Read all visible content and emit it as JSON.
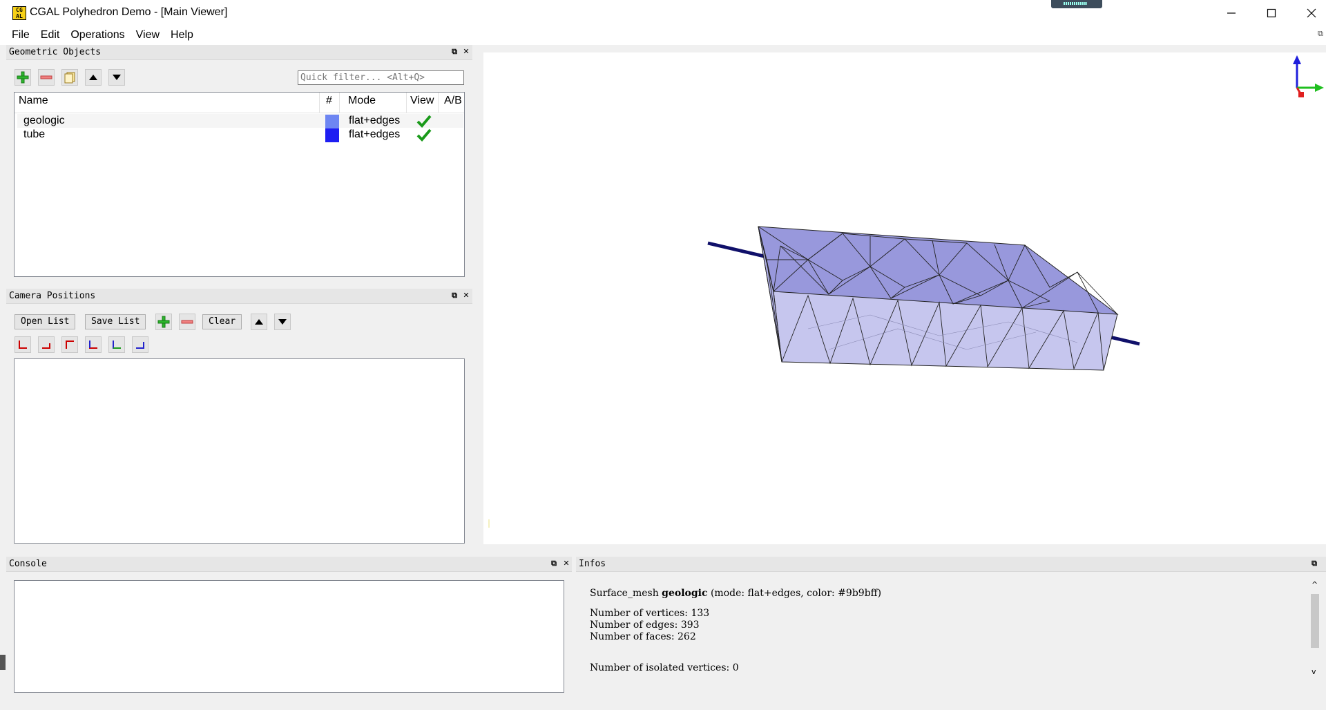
{
  "window": {
    "title": "CGAL Polyhedron Demo - [Main Viewer]",
    "icon_text_top": "CG",
    "icon_text_bottom": "AL"
  },
  "menu": [
    "File",
    "Edit",
    "Operations",
    "View",
    "Help"
  ],
  "geometric_objects": {
    "title": "Geometric Objects",
    "filter_placeholder": "Quick filter... <Alt+Q>",
    "columns": [
      "Name",
      "#",
      "Mode",
      "View",
      "A/B"
    ],
    "rows": [
      {
        "name": "geologic",
        "color": "#6e86f2",
        "mode": "flat+edges",
        "visible": true
      },
      {
        "name": "tube",
        "color": "#1e1ef2",
        "mode": "flat+edges",
        "visible": true
      }
    ]
  },
  "camera_positions": {
    "title": "Camera Positions",
    "open_list": "Open List",
    "save_list": "Save List",
    "clear": "Clear"
  },
  "console": {
    "title": "Console"
  },
  "infos": {
    "title": "Infos",
    "line1_prefix": "Surface_mesh ",
    "line1_name": "geologic",
    "line1_suffix": " (mode: flat+edges, color: #9b9bff)",
    "vertices": "Number of vertices: 133",
    "edges": "Number of edges: 393",
    "faces": "Number of faces: 262",
    "isolated": "Number of isolated vertices: 0"
  },
  "colors": {
    "mesh_top": "#8f8fdc",
    "mesh_side": "#c4c4ee",
    "tube": "#10106a",
    "check": "#1a9a1a"
  }
}
